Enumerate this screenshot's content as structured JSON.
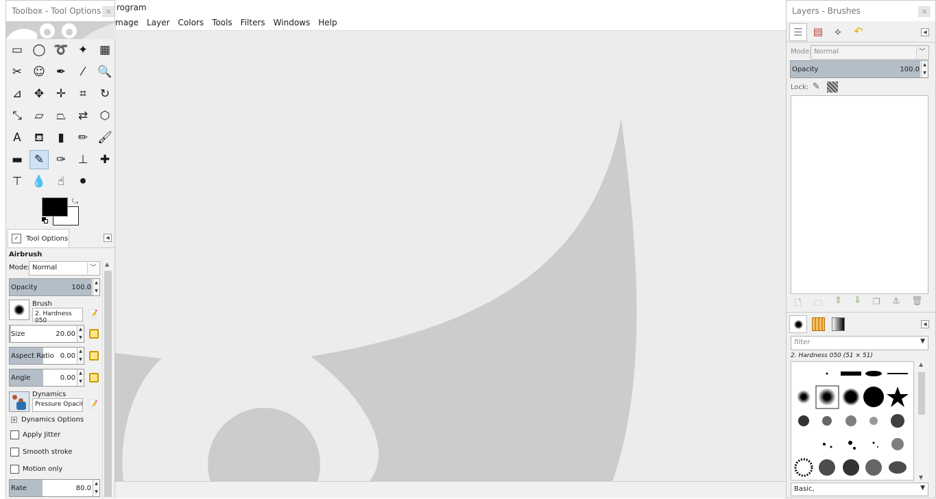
{
  "main_window": {
    "title": "rogram",
    "menu": [
      "mage",
      "Layer",
      "Colors",
      "Tools",
      "Filters",
      "Windows",
      "Help"
    ]
  },
  "toolbox": {
    "title": "Toolbox - Tool Options",
    "close": "×",
    "tools": [
      {
        "icon": "rect-select-icon",
        "glyph": "▭"
      },
      {
        "icon": "ellipse-select-icon",
        "glyph": "◯"
      },
      {
        "icon": "free-select-icon",
        "glyph": "➰"
      },
      {
        "icon": "fuzzy-select-icon",
        "glyph": "✦"
      },
      {
        "icon": "color-select-icon",
        "glyph": "▦"
      },
      {
        "icon": "scissors-icon",
        "glyph": "✂"
      },
      {
        "icon": "foreground-select-icon",
        "glyph": "☺"
      },
      {
        "icon": "paths-icon",
        "glyph": "✒"
      },
      {
        "icon": "color-picker-icon",
        "glyph": "⁄"
      },
      {
        "icon": "zoom-icon",
        "glyph": "🔍"
      },
      {
        "icon": "measure-icon",
        "glyph": "⊿"
      },
      {
        "icon": "move-icon",
        "glyph": "✥"
      },
      {
        "icon": "align-icon",
        "glyph": "✛"
      },
      {
        "icon": "crop-icon",
        "glyph": "⌗"
      },
      {
        "icon": "rotate-icon",
        "glyph": "↻"
      },
      {
        "icon": "scale-icon",
        "glyph": "⤡"
      },
      {
        "icon": "shear-icon",
        "glyph": "▱"
      },
      {
        "icon": "perspective-icon",
        "glyph": "⏢"
      },
      {
        "icon": "flip-icon",
        "glyph": "⇄"
      },
      {
        "icon": "cage-transform-icon",
        "glyph": "⬡"
      },
      {
        "icon": "text-tool-icon",
        "glyph": "A"
      },
      {
        "icon": "bucket-fill-icon",
        "glyph": "⛾"
      },
      {
        "icon": "gradient-icon",
        "glyph": "▮"
      },
      {
        "icon": "pencil-icon",
        "glyph": "✏"
      },
      {
        "icon": "paintbrush-icon",
        "glyph": "🖌"
      },
      {
        "icon": "eraser-icon",
        "glyph": "▬"
      },
      {
        "icon": "airbrush-icon",
        "glyph": "✎"
      },
      {
        "icon": "ink-icon",
        "glyph": "✑"
      },
      {
        "icon": "clone-icon",
        "glyph": "⊥"
      },
      {
        "icon": "heal-icon",
        "glyph": "✚"
      },
      {
        "icon": "perspective-clone-icon",
        "glyph": "⊤"
      },
      {
        "icon": "blur-sharpen-icon",
        "glyph": "💧"
      },
      {
        "icon": "smudge-icon",
        "glyph": "☝"
      },
      {
        "icon": "dodge-burn-icon",
        "glyph": "⚫"
      }
    ],
    "active_tool_index": 26,
    "colors": {
      "foreground": "#000000",
      "background": "#ffffff"
    }
  },
  "tool_options": {
    "tab_label": "Tool Options",
    "tool_name": "Airbrush",
    "mode_label": "Mode:",
    "mode_value": "Normal",
    "opacity": {
      "label": "Opacity",
      "value": "100.0",
      "fill": 1.0
    },
    "brush": {
      "label": "Brush",
      "value": "2. Hardness 050"
    },
    "size": {
      "label": "Size",
      "value": "20.00",
      "fill": 0.02
    },
    "aspect_ratio": {
      "label": "Aspect Ratio",
      "value": "0.00",
      "fill": 0.5
    },
    "angle": {
      "label": "Angle",
      "value": "0.00",
      "fill": 0.5
    },
    "dynamics": {
      "label": "Dynamics",
      "value": "Pressure Opacit"
    },
    "dynamics_options": "Dynamics Options",
    "checkboxes": [
      "Apply Jitter",
      "Smooth stroke",
      "Motion only"
    ],
    "rate": {
      "label": "Rate",
      "value": "80.0",
      "fill": 0.4
    }
  },
  "layers_dock": {
    "title": "Layers - Brushes",
    "close": "×",
    "mode_label": "Mode:",
    "mode_value": "Normal",
    "opacity": {
      "label": "Opacity",
      "value": "100.0",
      "fill": 1.0
    },
    "lock_label": "Lock:",
    "brushes": {
      "filter_placeholder": "filter",
      "selected_label": "2. Hardness 050 (51 × 51)",
      "tag_value": "Basic,"
    }
  }
}
